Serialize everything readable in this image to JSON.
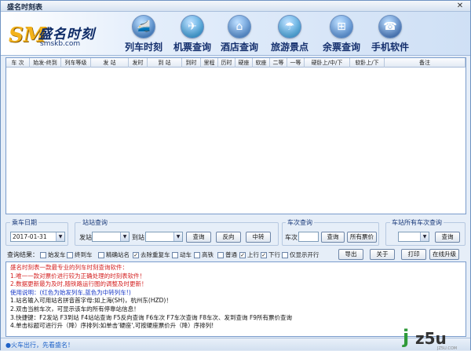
{
  "window": {
    "title": "盛名时刻表",
    "close_glyph": "✕"
  },
  "logo": {
    "mark": "SM",
    "name": "盛名时刻",
    "url": "smskb.com"
  },
  "nav": [
    {
      "label": "列车时刻",
      "icon": "train-icon",
      "color": "#2a6fc0",
      "glyph": "🚄"
    },
    {
      "label": "机票查询",
      "icon": "plane-icon",
      "color": "#1a8fd0",
      "glyph": "✈"
    },
    {
      "label": "酒店查询",
      "icon": "hotel-icon",
      "color": "#3a7ac8",
      "glyph": "⌂"
    },
    {
      "label": "旅游景点",
      "icon": "beach-icon",
      "color": "#2a9ad8",
      "glyph": "☂"
    },
    {
      "label": "余票查询",
      "icon": "windows-icon",
      "color": "#3f7fd0",
      "glyph": "⊞"
    },
    {
      "label": "手机软件",
      "icon": "phone-icon",
      "color": "#2a5fb0",
      "glyph": "☎"
    }
  ],
  "table": {
    "columns": [
      "车 次",
      "始发-终到",
      "列车等级",
      "发 站",
      "发时",
      "到 站",
      "到时",
      "里程",
      "历时",
      "硬座",
      "软座",
      "二等",
      "一等",
      "硬卧上/中/下",
      "软卧上/下",
      "备注"
    ]
  },
  "query": {
    "date_group": "乘车日期",
    "date_value": "2017-01-31",
    "station_group": "站站查询",
    "from_label": "发站",
    "to_label": "到站",
    "query_btn": "查询",
    "reverse_btn": "反向",
    "transfer_btn": "中转",
    "train_group": "车次查询",
    "train_label": "车次",
    "train_query_btn": "查询",
    "all_tickets_btn": "所有票价",
    "station_all_group": "车站所有车次查询",
    "station_query_btn": "查询"
  },
  "filter": {
    "label": "查询结果：",
    "options": [
      {
        "label": "始发车",
        "checked": false
      },
      {
        "label": "终到车",
        "checked": false
      },
      {
        "label": "精确站名",
        "checked": false
      },
      {
        "label": "去除重复车",
        "checked": true
      },
      {
        "label": "动车",
        "checked": false
      },
      {
        "label": "高铁",
        "checked": false
      },
      {
        "label": "普通",
        "checked": false
      },
      {
        "label": "上行",
        "checked": true
      },
      {
        "label": "下行",
        "checked": true
      },
      {
        "label": "仅显示开行",
        "checked": false
      }
    ],
    "check_glyph": "✓",
    "buttons": [
      "导出",
      "关于",
      "打印",
      "在线升级"
    ]
  },
  "info": {
    "lines": [
      {
        "text": "盛名时刻表一款最专业的列车时刻查询软件：",
        "color": "red"
      },
      {
        "text": "1.唯一一款对票价进行较为正确处理的时刻表软件！",
        "color": "red"
      },
      {
        "text": "2.数据更新最为及时,随铁路运行图的调整及时更新！",
        "color": "red"
      },
      {
        "text": "使用说明：(红色为始发列车,蓝色为中转列车!)",
        "color": "blue"
      },
      {
        "text": "1.站名输入可用站名拼音首字母:如上海(SH)，杭州东(HZD)！",
        "color": "black"
      },
      {
        "text": "2.双击当前车次，可显示该车的所有停靠站信息！",
        "color": "black"
      },
      {
        "text": "3.快捷键：F2发站 F3到站 F4站站查询 F5反向查询 F6车次 F7车次查询 F8车次、发到查询 F9所有票价查询",
        "color": "black"
      },
      {
        "text": "4.单击标题可进行升（降）序排列:如单击'硬座',可按硬座票价升（降）序排列!",
        "color": "black"
      }
    ]
  },
  "status": {
    "text": "●火车出行，先看盛名！"
  },
  "watermark": {
    "j": "j",
    "rest": "z5u",
    "sub": "JZ5U.COM"
  }
}
